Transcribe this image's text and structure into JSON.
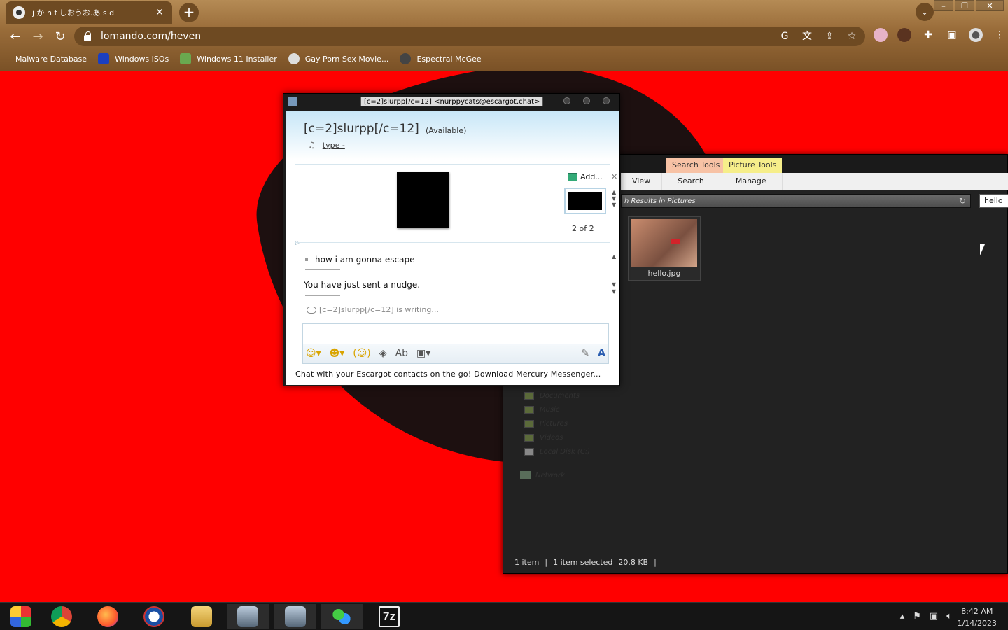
{
  "browser": {
    "tab_title": "j か h f しおうお.あ s d",
    "tab_close": "✕",
    "new_tab": "+",
    "url": "lomando.com/heven",
    "bookmarks": [
      {
        "label": "Malware Database",
        "color": "#7a5126"
      },
      {
        "label": "Windows ISOs",
        "color": "#1b3fbf"
      },
      {
        "label": "Windows 11 Installer",
        "color": "#6aa84f"
      },
      {
        "label": "Gay Porn Sex Movie...",
        "color": "#dddddd"
      },
      {
        "label": "Espectral McGee",
        "color": "#444444"
      }
    ]
  },
  "explorer": {
    "context_tabs": {
      "search_tools": "Search Tools",
      "picture_tools": "Picture Tools"
    },
    "ribbon": {
      "view": "View",
      "search": "Search",
      "manage": "Manage"
    },
    "address": "h Results in Pictures",
    "search_value": "hello",
    "file": {
      "name": "hello.jpg"
    },
    "nav": [
      "Documents",
      "Music",
      "Pictures",
      "Videos",
      "Local Disk (C:)"
    ],
    "network": "Network",
    "status": {
      "items": "1 item",
      "selected": "1 item selected",
      "size": "20.8 KB"
    }
  },
  "messenger": {
    "window_title": "[c=2]slurpp[/c=12] <nurppycats@escargot.chat>",
    "contact_name": "[c=2]slurpp[/c=12]",
    "contact_status": "(Available)",
    "psm": "type -",
    "add_label": "Add...",
    "pic_counter": "2 of 2",
    "messages": [
      "how i am gonna escape",
      "You have just sent a nudge."
    ],
    "typing": "[c=2]slurpp[/c=12] is writing...",
    "ad": "Chat with your Escargot contacts on the go! Download Mercury Messenger..."
  },
  "taskbar": {
    "apps": [
      "start",
      "chrome",
      "firefox",
      "opera",
      "explorer",
      "network-tool",
      "network-tool-2",
      "messenger",
      "7zip"
    ],
    "clock_time": "8:42 AM",
    "clock_date": "1/14/2023",
    "seven_zip_label": "7z"
  },
  "colors": {
    "desktop": "#ff0000",
    "chrome_accent": "#7a5126",
    "ctx_search": "#f7c2a5",
    "ctx_picture": "#f6ee8a"
  }
}
